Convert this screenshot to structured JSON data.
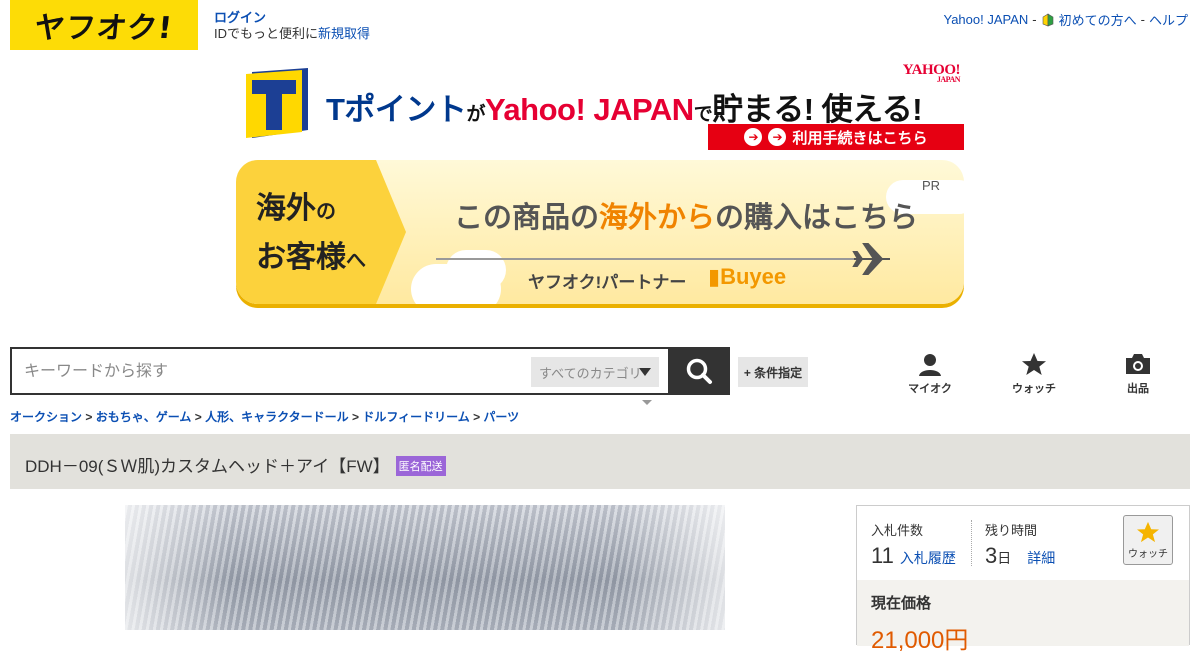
{
  "header": {
    "logo_text": "ヤフオク!",
    "login_label": "ログイン",
    "signup_prefix": "IDでもっと便利に",
    "signup_link": "新規取得",
    "top_links": [
      "Yahoo! JAPAN",
      "初めての方へ",
      "ヘルプ"
    ],
    "separator": "-"
  },
  "tpoint_banner": {
    "yahoo_logo": "YAHOO!",
    "yahoo_logo_sub": "JAPAN",
    "headline_part1": "Tポイント",
    "headline_part2": "が",
    "headline_part3": "Yahoo! JAPAN",
    "headline_part4": "で",
    "headline_part5": "貯まる! 使える!",
    "cta": "利用手続きはこちら",
    "cta_arrows": "➔➔"
  },
  "overseas_banner": {
    "left_line1": "海外",
    "left_line1_small": "の",
    "left_line2": "お客様",
    "left_line2_small": "へ",
    "message_part1": "この商品の",
    "message_part2": "海外から",
    "message_part3": "の購入はこちら",
    "pr": "PR",
    "partner": "ヤフオク!パートナー",
    "buyee": "Buyee"
  },
  "search": {
    "placeholder": "キーワードから探す",
    "category": "すべてのカテゴリ",
    "conditions_button": "+ 条件指定"
  },
  "nav": {
    "myauc": "マイオク",
    "watch": "ウォッチ",
    "sell": "出品"
  },
  "breadcrumb": [
    "オークション",
    "おもちゃ、ゲーム",
    "人形、キャラクタードール",
    "ドルフィードリーム",
    "パーツ"
  ],
  "breadcrumb_sep": ">",
  "item": {
    "title": "DDH－09(ＳＷ肌)カスタムヘッド＋アイ【FW】",
    "badge": "匿名配送"
  },
  "bid": {
    "bids_label": "入札件数",
    "bids_count": "11",
    "bids_history": "入札履歴",
    "time_label": "残り時間",
    "time_value": "3",
    "time_unit": "日",
    "time_detail": "詳細",
    "watch_label": "ウォッチ",
    "current_price_label": "現在価格",
    "current_price": "21,000円"
  },
  "colors": {
    "logo_yellow": "#fddc06",
    "link_blue": "#0b4fb3",
    "badge_purple": "#9b66d8",
    "price_orange": "#e05a00"
  },
  "icons": [
    "beginner-leaf-icon",
    "search-icon",
    "person-icon",
    "star-icon",
    "camera-icon",
    "caret-down-icon"
  ]
}
